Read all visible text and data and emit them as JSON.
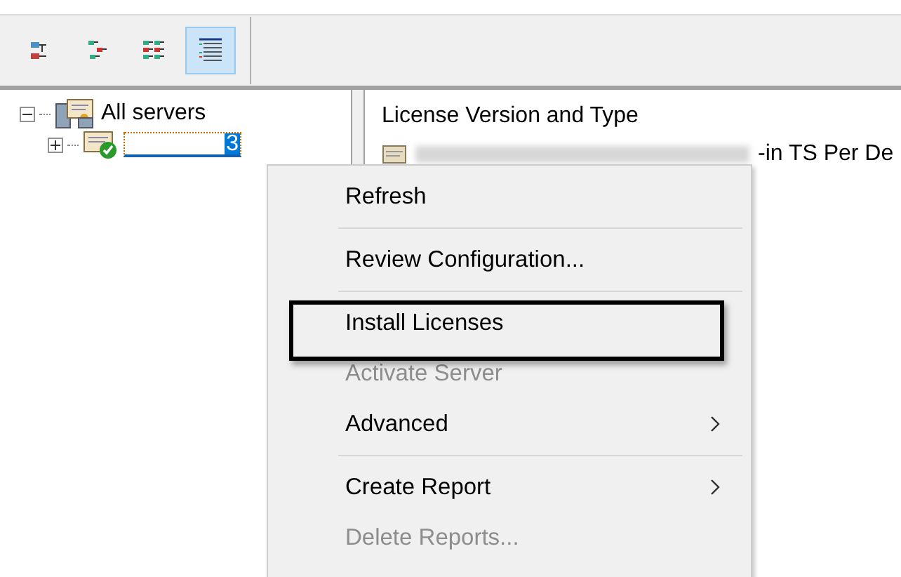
{
  "toolbar": {
    "buttons": [
      {
        "kind": "tree",
        "selected": false
      },
      {
        "kind": "steps",
        "selected": false
      },
      {
        "kind": "grid",
        "selected": false
      },
      {
        "kind": "list",
        "selected": true
      }
    ]
  },
  "tree": {
    "items": [
      {
        "label": "All servers",
        "expanded": true,
        "children": [
          {
            "label": "3",
            "expanded": false,
            "selected": true
          }
        ]
      }
    ]
  },
  "list": {
    "column": "License Version and Type",
    "rows": [
      {
        "text": "-in TS Per De"
      }
    ]
  },
  "context_menu": {
    "items": [
      {
        "label": "Refresh",
        "disabled": false,
        "submenu": false,
        "separator_after": true
      },
      {
        "label": "Review Configuration...",
        "disabled": false,
        "submenu": false,
        "separator_after": true
      },
      {
        "label": "Install Licenses",
        "disabled": false,
        "submenu": false,
        "separator_after": false,
        "highlighted": true
      },
      {
        "label": "Activate Server",
        "disabled": true,
        "submenu": false,
        "separator_after": false
      },
      {
        "label": "Advanced",
        "disabled": false,
        "submenu": true,
        "separator_after": true
      },
      {
        "label": "Create Report",
        "disabled": false,
        "submenu": true,
        "separator_after": false
      },
      {
        "label": "Delete Reports...",
        "disabled": true,
        "submenu": false,
        "separator_after": false
      }
    ]
  }
}
